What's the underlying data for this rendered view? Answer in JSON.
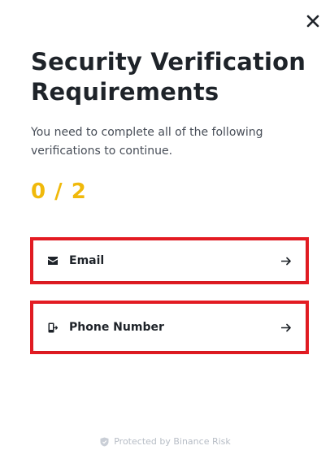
{
  "dialog": {
    "title": "Security Verification Requirements",
    "subtitle": "You need to complete all of the following verifications to continue.",
    "progress": "0 / 2",
    "close_icon": "close-icon"
  },
  "options": [
    {
      "label": "Email",
      "icon": "envelope-icon",
      "arrow": "arrow-right-icon"
    },
    {
      "label": "Phone Number",
      "icon": "phone-icon",
      "arrow": "arrow-right-icon"
    }
  ],
  "footer": {
    "text": "Protected by Binance Risk",
    "icon": "shield-icon"
  },
  "colors": {
    "accent": "#f0b90b",
    "highlight_border": "#e51c23",
    "text_primary": "#1e2329",
    "text_secondary": "#474d57",
    "footer_text": "#b7bdc6"
  }
}
